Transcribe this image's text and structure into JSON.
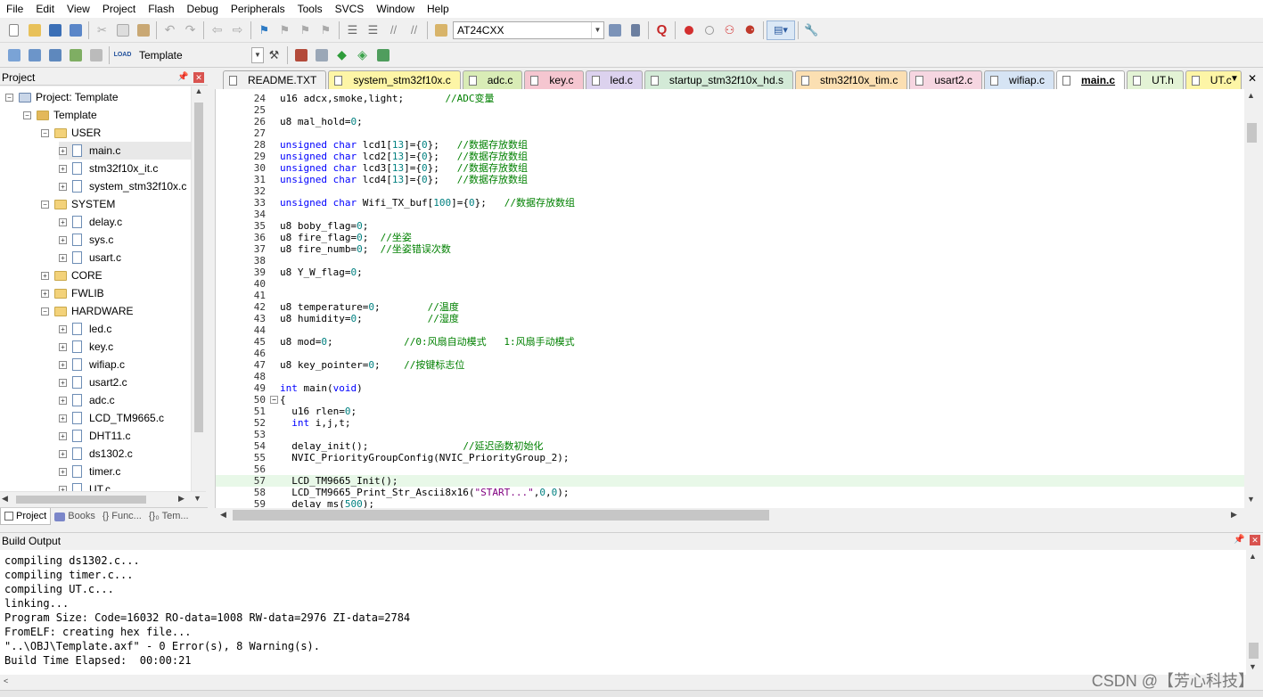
{
  "menu": [
    "File",
    "Edit",
    "View",
    "Project",
    "Flash",
    "Debug",
    "Peripherals",
    "Tools",
    "SVCS",
    "Window",
    "Help"
  ],
  "toolbar": {
    "find_combo": "AT24CXX",
    "target_combo": "Template",
    "load_label": "LOAD"
  },
  "project_panel": {
    "title": "Project",
    "root": "Project: Template",
    "target": "Template",
    "groups": {
      "user": "USER",
      "system": "SYSTEM",
      "core": "CORE",
      "fwlib": "FWLIB",
      "hardware": "HARDWARE"
    },
    "user_files": [
      "main.c",
      "stm32f10x_it.c",
      "system_stm32f10x.c"
    ],
    "system_files": [
      "delay.c",
      "sys.c",
      "usart.c"
    ],
    "hardware_files": [
      "led.c",
      "key.c",
      "wifiap.c",
      "usart2.c",
      "adc.c",
      "LCD_TM9665.c",
      "DHT11.c",
      "ds1302.c",
      "timer.c",
      "UT.c"
    ],
    "tabs": [
      "Project",
      "Books",
      "{} Func...",
      "{}₀ Tem..."
    ]
  },
  "file_tabs": [
    {
      "label": "README.TXT",
      "color": "#f0f0f0"
    },
    {
      "label": "system_stm32f10x.c",
      "color": "#fdf5a6"
    },
    {
      "label": "adc.c",
      "color": "#d9ecb6"
    },
    {
      "label": "key.c",
      "color": "#f5c6d0"
    },
    {
      "label": "led.c",
      "color": "#dcd2ee"
    },
    {
      "label": "startup_stm32f10x_hd.s",
      "color": "#d3ead7"
    },
    {
      "label": "stm32f10x_tim.c",
      "color": "#fbdfb2"
    },
    {
      "label": "usart2.c",
      "color": "#f6d6e1"
    },
    {
      "label": "wifiap.c",
      "color": "#d6e4f4"
    },
    {
      "label": "main.c",
      "color": "#ffffff"
    },
    {
      "label": "UT.h",
      "color": "#e3f3d5"
    },
    {
      "label": "UT.c",
      "color": "#fdf5a6"
    }
  ],
  "code_lines": [
    {
      "n": "24",
      "t": "u16 adcx,smoke,light;       //ADC变量"
    },
    {
      "n": "25",
      "t": ""
    },
    {
      "n": "26",
      "t": "u8 mal_hold=0;"
    },
    {
      "n": "27",
      "t": ""
    },
    {
      "n": "28",
      "t": "unsigned char lcd1[13]={0};   //数据存放数组"
    },
    {
      "n": "29",
      "t": "unsigned char lcd2[13]={0};   //数据存放数组"
    },
    {
      "n": "30",
      "t": "unsigned char lcd3[13]={0};   //数据存放数组"
    },
    {
      "n": "31",
      "t": "unsigned char lcd4[13]={0};   //数据存放数组"
    },
    {
      "n": "32",
      "t": ""
    },
    {
      "n": "33",
      "t": "unsigned char Wifi_TX_buf[100]={0};   //数据存放数组"
    },
    {
      "n": "34",
      "t": ""
    },
    {
      "n": "35",
      "t": "u8 boby_flag=0;"
    },
    {
      "n": "36",
      "t": "u8 fire_flag=0;  //坐姿"
    },
    {
      "n": "37",
      "t": "u8 fire_numb=0;  //坐姿错误次数"
    },
    {
      "n": "38",
      "t": ""
    },
    {
      "n": "39",
      "t": "u8 Y_W_flag=0;"
    },
    {
      "n": "40",
      "t": ""
    },
    {
      "n": "41",
      "t": ""
    },
    {
      "n": "42",
      "t": "u8 temperature=0;        //温度"
    },
    {
      "n": "43",
      "t": "u8 humidity=0;           //湿度"
    },
    {
      "n": "44",
      "t": ""
    },
    {
      "n": "45",
      "t": "u8 mod=0;            //0:风扇自动模式   1:风扇手动模式"
    },
    {
      "n": "46",
      "t": ""
    },
    {
      "n": "47",
      "t": "u8 key_pointer=0;    //按键标志位"
    },
    {
      "n": "48",
      "t": ""
    },
    {
      "n": "49",
      "t": "int main(void)"
    },
    {
      "n": "50",
      "t": "{"
    },
    {
      "n": "51",
      "t": "  u16 rlen=0;"
    },
    {
      "n": "52",
      "t": "  int i,j,t;"
    },
    {
      "n": "53",
      "t": ""
    },
    {
      "n": "54",
      "t": "  delay_init();                //延迟函数初始化"
    },
    {
      "n": "55",
      "t": "  NVIC_PriorityGroupConfig(NVIC_PriorityGroup_2);"
    },
    {
      "n": "56",
      "t": ""
    },
    {
      "n": "57",
      "t": "  LCD_TM9665_Init();"
    },
    {
      "n": "58",
      "t": "  LCD_TM9665_Print_Str_Ascii8x16(\"START...\",0,0);"
    },
    {
      "n": "59",
      "t": "  delay_ms(500);"
    }
  ],
  "build_output": {
    "title": "Build Output",
    "lines": [
      "compiling ds1302.c...",
      "compiling timer.c...",
      "compiling UT.c...",
      "linking...",
      "Program Size: Code=16032 RO-data=1008 RW-data=2976 ZI-data=2784",
      "FromELF: creating hex file...",
      "\"..\\OBJ\\Template.axf\" - 0 Error(s), 8 Warning(s).",
      "Build Time Elapsed:  00:00:21"
    ]
  },
  "watermark": "CSDN @【芳心科技】"
}
